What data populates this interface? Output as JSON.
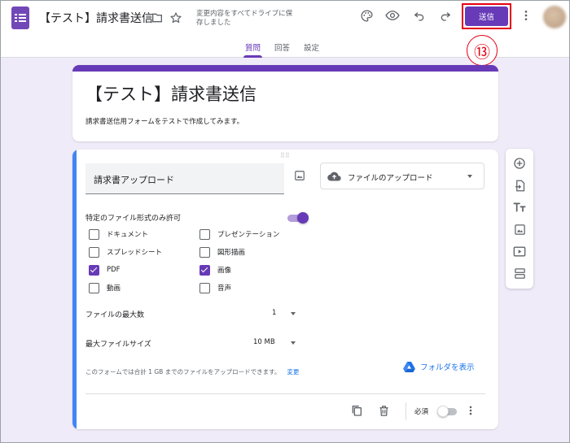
{
  "header": {
    "doc_title": "【テスト】請求書送信",
    "save_status": "変更内容をすべてドライブに保存しました",
    "send_label": "送信",
    "annotation": "⑬",
    "icons": [
      "folder-icon",
      "star-icon",
      "palette-icon",
      "preview-icon",
      "undo-icon",
      "redo-icon",
      "more-vert-icon"
    ]
  },
  "tabs": [
    {
      "label": "質問",
      "active": true
    },
    {
      "label": "回答",
      "active": false
    },
    {
      "label": "設定",
      "active": false
    }
  ],
  "form": {
    "title": "【テスト】請求書送信",
    "description": "請求書送信用フォームをテストで作成してみます。"
  },
  "question": {
    "title": "請求書アップロード",
    "type": "ファイルのアップロード",
    "restrict_label": "特定のファイル形式のみ許可",
    "restrict_enabled": true,
    "file_types": [
      {
        "label": "ドキュメント",
        "checked": false
      },
      {
        "label": "プレゼンテーション",
        "checked": false
      },
      {
        "label": "スプレッドシート",
        "checked": false
      },
      {
        "label": "図形描画",
        "checked": false
      },
      {
        "label": "PDF",
        "checked": true
      },
      {
        "label": "画像",
        "checked": true
      },
      {
        "label": "動画",
        "checked": false
      },
      {
        "label": "音声",
        "checked": false
      }
    ],
    "max_files_label": "ファイルの最大数",
    "max_files_value": "1",
    "max_size_label": "最大ファイルサイズ",
    "max_size_value": "10 MB",
    "note": "このフォームでは合計 1 GB までのファイルをアップロードできます。",
    "note_link": "変更",
    "folder_link": "フォルダを表示",
    "required_label": "必須",
    "required_enabled": false
  },
  "colors": {
    "accent": "#673ab7",
    "background": "#f0ebf8",
    "active_card": "#4285f4",
    "annotation": "#e50012"
  }
}
